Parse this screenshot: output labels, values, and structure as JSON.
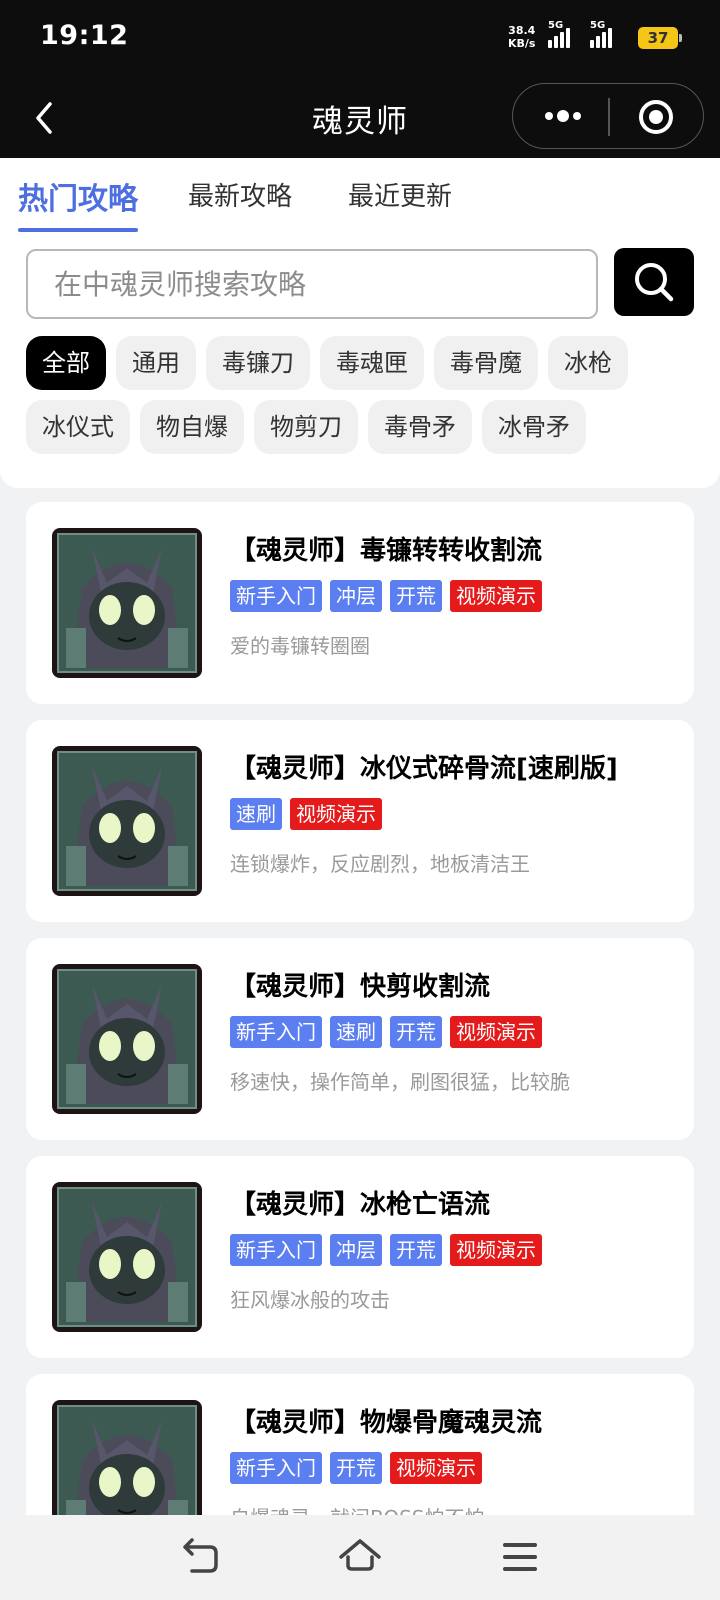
{
  "status_bar": {
    "time": "19:12",
    "net_speed_value": "38.4",
    "net_speed_unit": "KB/s",
    "sim1": "5G",
    "sim2": "5G",
    "battery": "37"
  },
  "nav": {
    "title": "魂灵师"
  },
  "tabs": [
    {
      "label": "热门攻略",
      "active": true
    },
    {
      "label": "最新攻略",
      "active": false
    },
    {
      "label": "最近更新",
      "active": false
    }
  ],
  "search": {
    "placeholder": "在中魂灵师搜索攻略",
    "value": ""
  },
  "filters": {
    "row1": [
      "全部",
      "通用",
      "毒镰刀",
      "毒魂匣",
      "毒骨魔",
      "冰枪"
    ],
    "row2": [
      "冰仪式",
      "物自爆",
      "物剪刀",
      "毒骨矛",
      "冰骨矛"
    ],
    "selected": "全部"
  },
  "guides": [
    {
      "title": "【魂灵师】毒镰转转收割流",
      "tags": [
        "新手入门",
        "冲层",
        "开荒",
        "视频演示"
      ],
      "desc": "爱的毒镰转圈圈"
    },
    {
      "title": "【魂灵师】冰仪式碎骨流[速刷版]",
      "tags": [
        "速刷",
        "视频演示"
      ],
      "desc": "连锁爆炸，反应剧烈，地板清洁王"
    },
    {
      "title": "【魂灵师】快剪收割流",
      "tags": [
        "新手入门",
        "速刷",
        "开荒",
        "视频演示"
      ],
      "desc": "移速快，操作简单，刷图很猛，比较脆"
    },
    {
      "title": "【魂灵师】冰枪亡语流",
      "tags": [
        "新手入门",
        "冲层",
        "开荒",
        "视频演示"
      ],
      "desc": "狂风爆冰般的攻击"
    },
    {
      "title": "【魂灵师】物爆骨魔魂灵流",
      "tags": [
        "新手入门",
        "开荒",
        "视频演示"
      ],
      "desc": "自爆魂灵，就问BOSS怕不怕"
    }
  ],
  "colors": {
    "accent": "#4d6fe0",
    "tag_blue": "#5b7ff0",
    "tag_red": "#e51a1a"
  }
}
